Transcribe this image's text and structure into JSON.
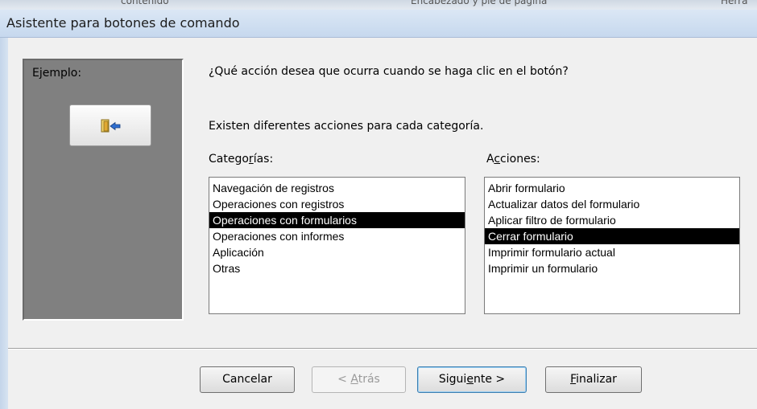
{
  "window": {
    "title": "Asistente para botones de comando",
    "background_hint": [
      "contenido",
      "Encabezado y pie de página",
      "Herra"
    ]
  },
  "example": {
    "label": "Ejemplo:",
    "button_icon": "close-form-door-icon"
  },
  "prompt": {
    "question": "¿Qué acción desea que ocurra cuando se haga clic en el botón?",
    "info": "Existen diferentes acciones para cada categoría."
  },
  "categories": {
    "label_pre": "Catego",
    "label_key": "r",
    "label_post": "ías:",
    "items": [
      "Navegación de registros",
      "Operaciones con registros",
      "Operaciones con formularios",
      "Operaciones con informes",
      "Aplicación",
      "Otras"
    ],
    "selected_index": 2
  },
  "actions": {
    "label_pre": "A",
    "label_key": "c",
    "label_post": "ciones:",
    "items": [
      "Abrir formulario",
      "Actualizar datos del formulario",
      "Aplicar filtro de formulario",
      "Cerrar formulario",
      "Imprimir formulario actual",
      "Imprimir un formulario"
    ],
    "selected_index": 3
  },
  "buttons": {
    "cancel": "Cancelar",
    "back_pre": "< ",
    "back_key": "A",
    "back_post": "trás",
    "next_pre": "Sigui",
    "next_key": "e",
    "next_post": "nte >",
    "finish_key": "F",
    "finish_post": "inalizar"
  },
  "colors": {
    "selection_bg": "#000000",
    "selection_fg": "#ffffff",
    "example_panel": "#808080"
  }
}
